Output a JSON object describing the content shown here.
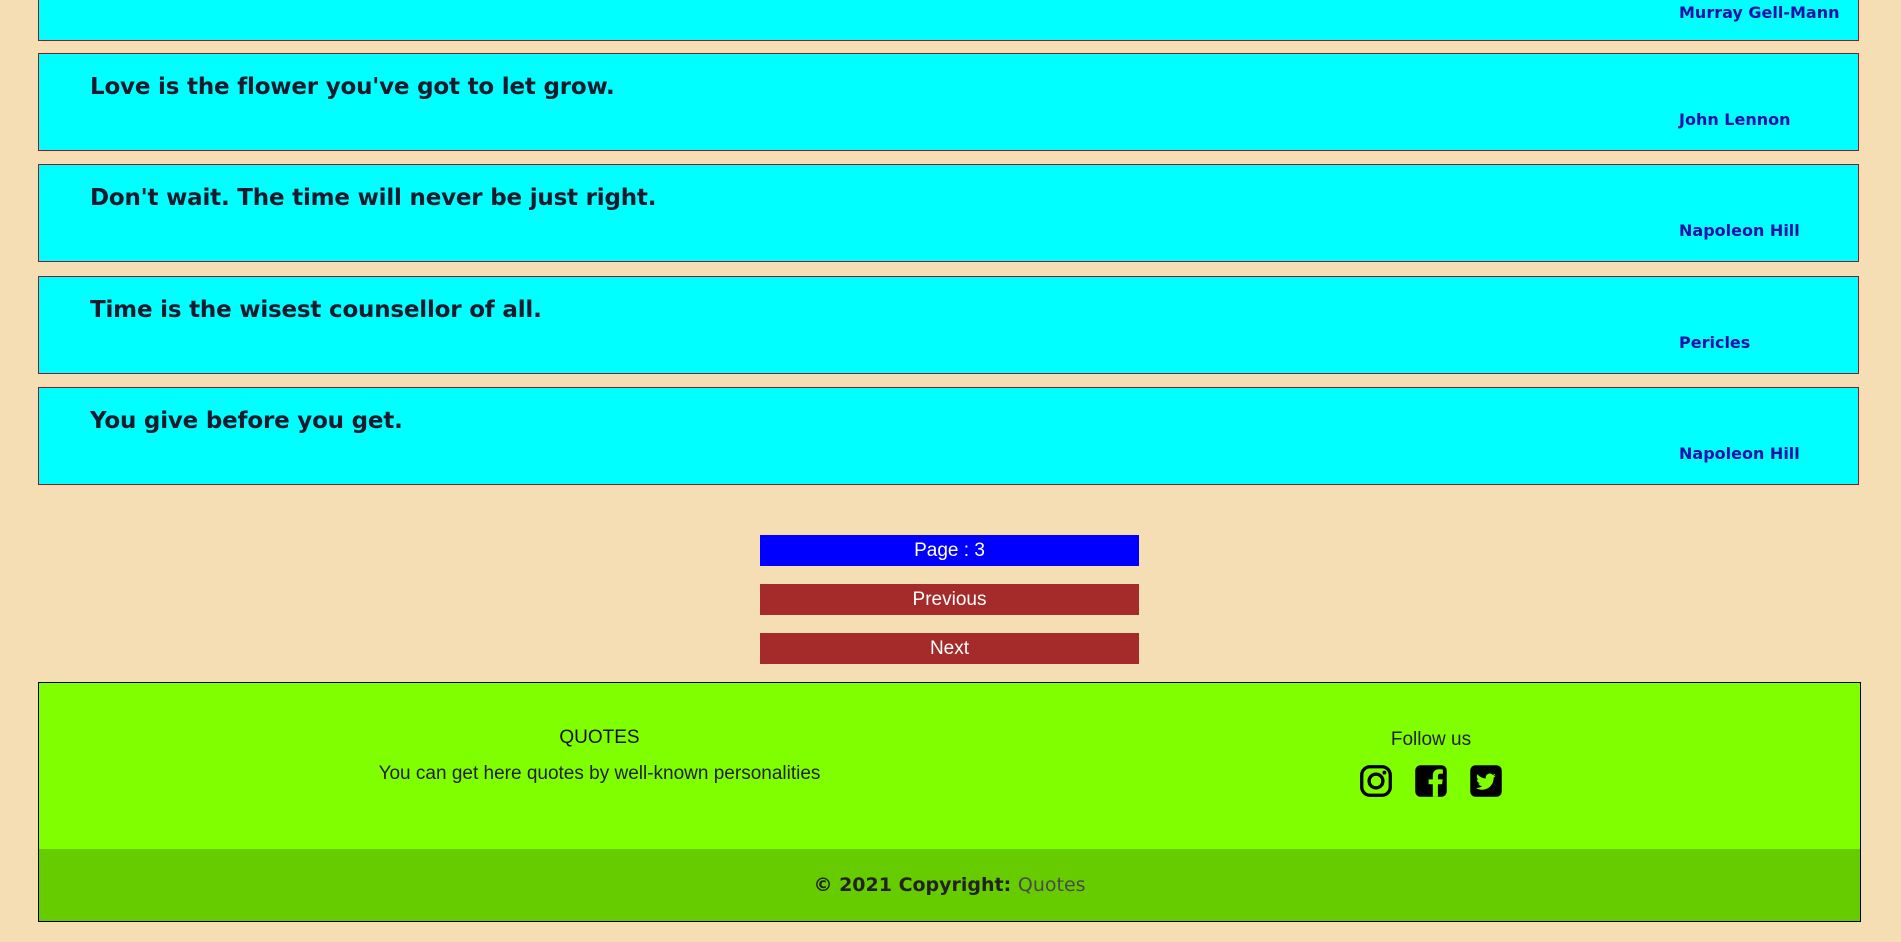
{
  "quotes": [
    {
      "text": "",
      "author": "Murray Gell-Mann"
    },
    {
      "text": "Love is the flower you've got to let grow.",
      "author": "John Lennon"
    },
    {
      "text": "Don't wait. The time will never be just right.",
      "author": "Napoleon Hill"
    },
    {
      "text": "Time is the wisest counsellor of all.",
      "author": "Pericles"
    },
    {
      "text": "You give before you get.",
      "author": "Napoleon Hill"
    }
  ],
  "pager": {
    "page_label": "Page : 3",
    "previous_label": "Previous",
    "next_label": "Next"
  },
  "footer": {
    "brand": "QUOTES",
    "description": "You can get here quotes by well-known personalities",
    "follow_label": "Follow us",
    "social": [
      "instagram-icon",
      "facebook-icon",
      "twitter-icon"
    ],
    "copyright_prefix": "© 2021 Copyright:",
    "copyright_link": "Quotes"
  },
  "colors": {
    "background": "#f5deb3",
    "card": "#00ffff",
    "page_indicator": "#0000ff",
    "button": "#a52a2a",
    "footer": "#80ff00",
    "footer_bottom": "#66cc00"
  }
}
